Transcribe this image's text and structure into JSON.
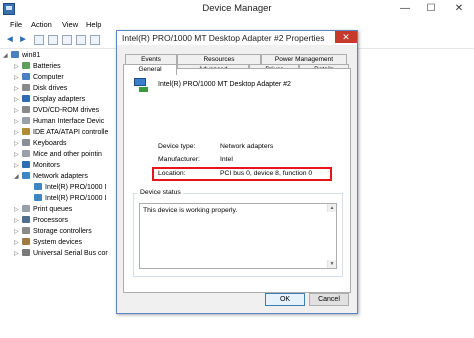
{
  "window": {
    "title": "Device Manager",
    "controls": {
      "minimize": "—",
      "maximize": "☐",
      "close": "✕"
    }
  },
  "menu": [
    "File",
    "Action",
    "View",
    "Help"
  ],
  "toolbar": {
    "back": "◀",
    "forward": "▶"
  },
  "tree": {
    "root": "win81",
    "items": [
      {
        "label": "Batteries",
        "icon": "battery-icon",
        "expanded": false
      },
      {
        "label": "Computer",
        "icon": "computer-icon",
        "expanded": false
      },
      {
        "label": "Disk drives",
        "icon": "disk-icon",
        "expanded": false
      },
      {
        "label": "Display adapters",
        "icon": "display-icon",
        "expanded": false
      },
      {
        "label": "DVD/CD-ROM drives",
        "icon": "dvd-icon",
        "expanded": false
      },
      {
        "label": "Human Interface Devic",
        "icon": "hid-icon",
        "expanded": false
      },
      {
        "label": "IDE ATA/ATAPI controlle",
        "icon": "ide-icon",
        "expanded": false
      },
      {
        "label": "Keyboards",
        "icon": "keyboard-icon",
        "expanded": false
      },
      {
        "label": "Mice and other pointin",
        "icon": "mouse-icon",
        "expanded": false
      },
      {
        "label": "Monitors",
        "icon": "monitor-icon",
        "expanded": false
      },
      {
        "label": "Network adapters",
        "icon": "network-icon",
        "expanded": true
      },
      {
        "label": "Intel(R) PRO/1000 I",
        "icon": "network-adapter-icon",
        "child": true
      },
      {
        "label": "Intel(R) PRO/1000 I",
        "icon": "network-adapter-icon",
        "child": true
      },
      {
        "label": "Print queues",
        "icon": "printer-icon",
        "expanded": false
      },
      {
        "label": "Processors",
        "icon": "processor-icon",
        "expanded": false
      },
      {
        "label": "Storage controllers",
        "icon": "storage-icon",
        "expanded": false
      },
      {
        "label": "System devices",
        "icon": "system-icon",
        "expanded": false
      },
      {
        "label": "Universal Serial Bus cor",
        "icon": "usb-icon",
        "expanded": false
      }
    ]
  },
  "dialog": {
    "title": "Intel(R) PRO/1000 MT Desktop Adapter #2 Properties",
    "close": "✕",
    "tabs_back": [
      "Events",
      "Resources",
      "Power Management"
    ],
    "tabs_front": [
      "General",
      "Advanced",
      "Driver",
      "Details"
    ],
    "selected_tab": "General",
    "device_name": "Intel(R) PRO/1000 MT Desktop Adapter #2",
    "props": [
      {
        "label": "Device type:",
        "value": "Network adapters"
      },
      {
        "label": "Manufacturer:",
        "value": "Intel"
      },
      {
        "label": "Location:",
        "value": "PCI bus 0, device 8, function 0"
      }
    ],
    "status_group_label": "Device status",
    "status_text": "This device is working properly.",
    "ok": "OK",
    "cancel": "Cancel",
    "highlight_color": "#e8141d"
  }
}
